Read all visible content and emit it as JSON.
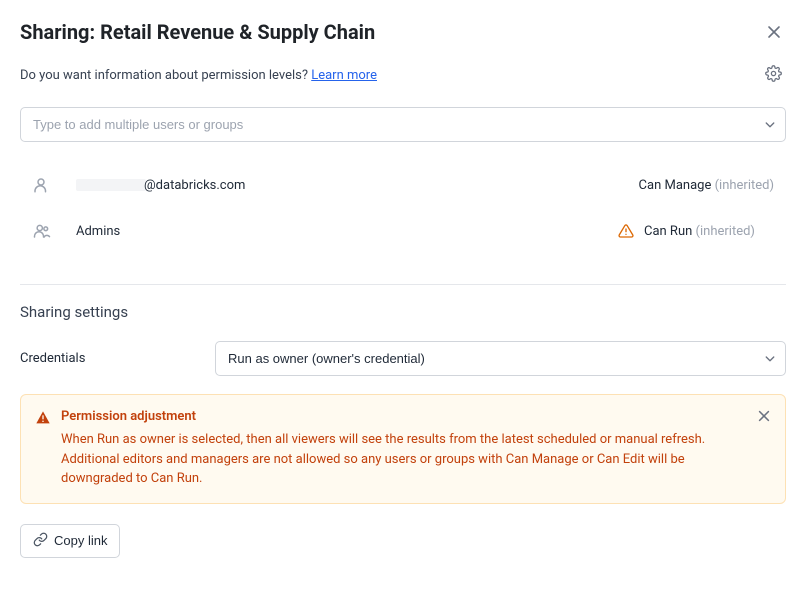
{
  "header": {
    "title": "Sharing: Retail Revenue & Supply Chain",
    "question": "Do you want information about permission levels? ",
    "learn_more": "Learn more"
  },
  "search": {
    "placeholder": "Type to add multiple users or groups"
  },
  "permissions": [
    {
      "name_suffix": "@databricks.com",
      "redacted_prefix": true,
      "level": "Can Manage",
      "inherited": "(inherited)",
      "warn": false,
      "icon": "user"
    },
    {
      "name": "Admins",
      "level": "Can Run",
      "inherited": "(inherited)",
      "warn": true,
      "icon": "group"
    }
  ],
  "settings": {
    "section_title": "Sharing settings",
    "credentials_label": "Credentials",
    "credentials_value": "Run as owner (owner's credential)"
  },
  "alert": {
    "title": "Permission adjustment",
    "body": "When Run as owner is selected, then all viewers will see the results from the latest scheduled or manual refresh. Additional editors and managers are not allowed so any users or groups with Can Manage or Can Edit will be downgraded to Can Run."
  },
  "footer": {
    "copy_link": "Copy link"
  }
}
